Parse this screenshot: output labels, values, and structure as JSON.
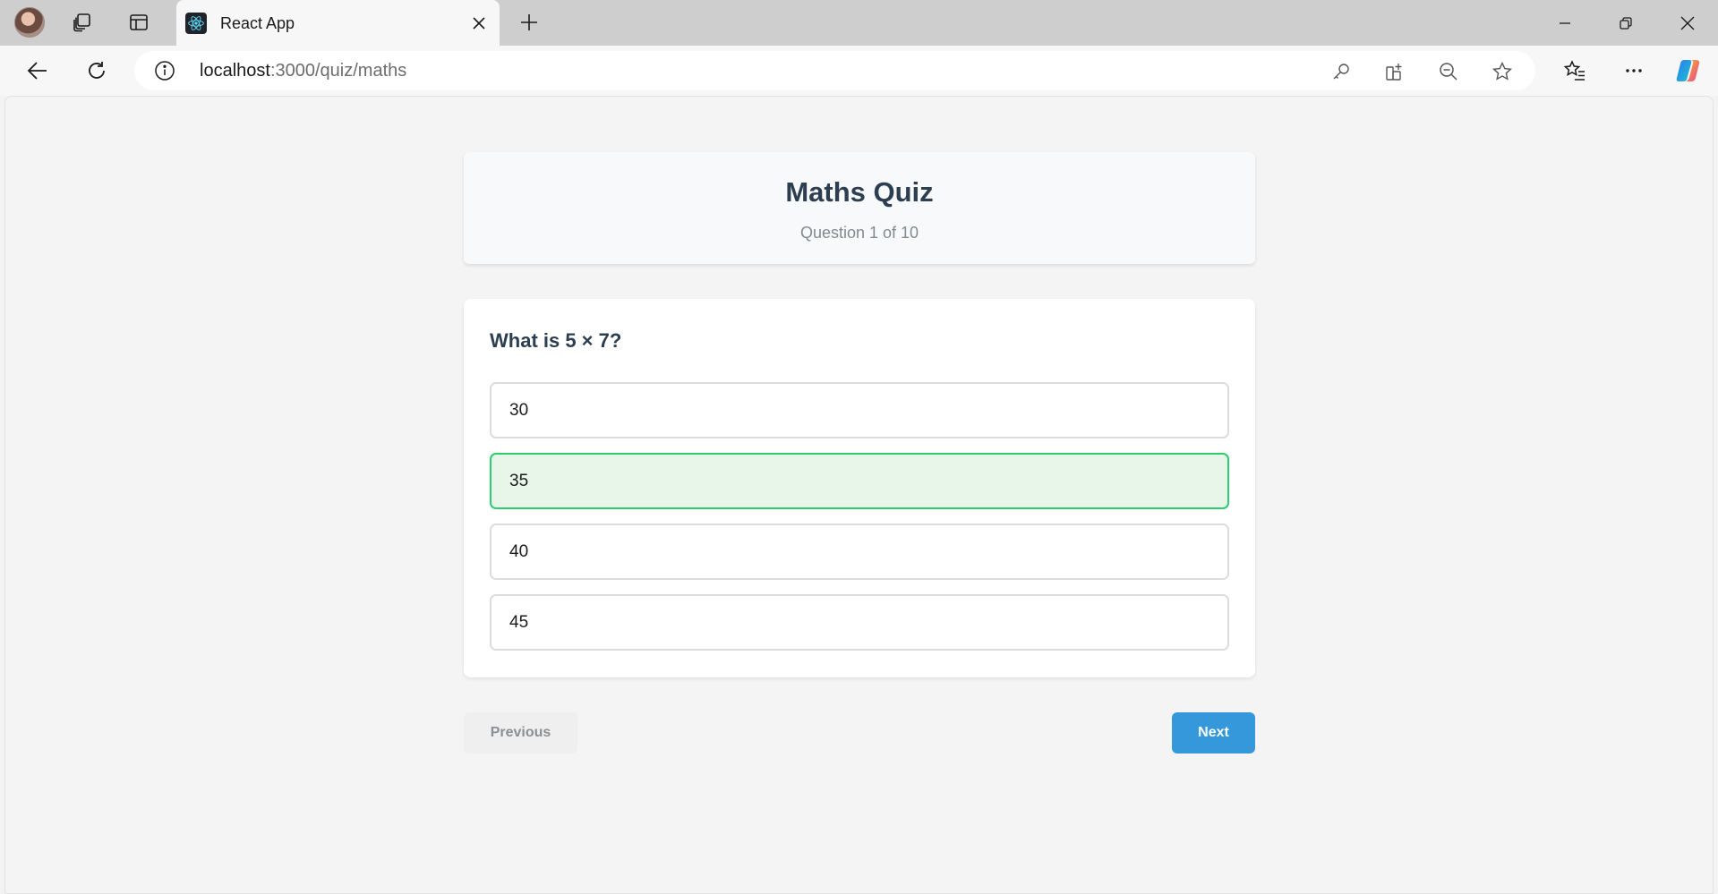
{
  "browser": {
    "tab": {
      "title": "React App",
      "favicon": "react-logo-icon"
    },
    "address": {
      "host": "localhost",
      "path": ":3000/quiz/maths"
    },
    "icons": {
      "profile": "avatar",
      "workspaces": "workspaces-icon",
      "tab_actions": "vertical-tabs-icon",
      "close_tab": "close-icon",
      "new_tab": "plus-icon",
      "minimize": "minimize-icon",
      "restore": "restore-icon",
      "close_window": "close-icon",
      "back": "back-arrow-icon",
      "refresh": "refresh-icon",
      "site_info": "info-icon",
      "password": "key-icon",
      "apps": "apps-icon",
      "zoom": "zoom-out-icon",
      "favorite": "star-icon",
      "favorites": "favorites-icon",
      "more": "more-icon",
      "copilot": "copilot-icon"
    }
  },
  "quiz": {
    "title": "Maths Quiz",
    "progress": "Question 1 of 10",
    "question": "What is 5 × 7?",
    "options": [
      {
        "label": "30",
        "selected": false
      },
      {
        "label": "35",
        "selected": true
      },
      {
        "label": "40",
        "selected": false
      },
      {
        "label": "45",
        "selected": false
      }
    ],
    "prev_label": "Previous",
    "next_label": "Next"
  },
  "colors": {
    "title": "#2c3e50",
    "selected_border": "#2ecc71",
    "selected_bg": "#e8f5e9",
    "next_button": "#3498db"
  }
}
